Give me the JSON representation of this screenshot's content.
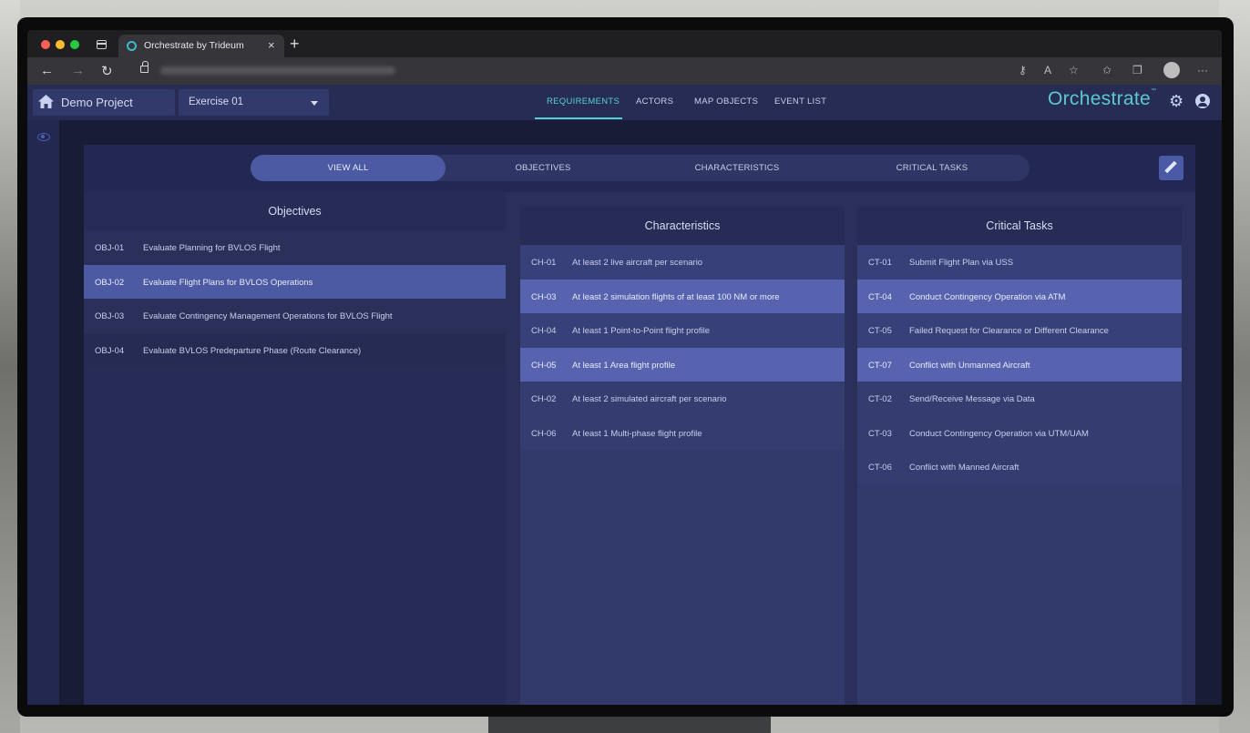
{
  "browser": {
    "tab_title": "Orchestrate by Trideum",
    "tab_close": "×",
    "new_tab": "+"
  },
  "app": {
    "project": "Demo Project",
    "exercise": "Exercise 01",
    "nav_tabs": [
      {
        "label": "REQUIREMENTS",
        "active": true
      },
      {
        "label": "ACTORS",
        "active": false
      },
      {
        "label": "MAP OBJECTS",
        "active": false
      },
      {
        "label": "EVENT LIST",
        "active": false
      }
    ],
    "brand": "Orchestrate",
    "brand_tm": "™",
    "accent_color": "#55d0d0",
    "icons": [
      "home-icon",
      "chevron-down-icon",
      "gear-icon",
      "user-icon",
      "eye-icon",
      "pencil-icon"
    ]
  },
  "filters": [
    {
      "label": "VIEW ALL",
      "active": true
    },
    {
      "label": "OBJECTIVES",
      "active": false
    },
    {
      "label": "CHARACTERISTICS",
      "active": false
    },
    {
      "label": "CRITICAL TASKS",
      "active": false
    }
  ],
  "objectives": {
    "title": "Objectives",
    "items": [
      {
        "code": "OBJ-01",
        "label": "Evaluate Planning for BVLOS Flight",
        "selected": false
      },
      {
        "code": "OBJ-02",
        "label": "Evaluate Flight Plans for BVLOS Operations",
        "selected": true
      },
      {
        "code": "OBJ-03",
        "label": "Evaluate Contingency Management Operations for BVLOS Flight",
        "selected": false
      },
      {
        "code": "OBJ-04",
        "label": "Evaluate BVLOS Predeparture Phase (Route Clearance)",
        "selected": false
      }
    ]
  },
  "characteristics": {
    "title": "Characteristics",
    "items": [
      {
        "code": "CH-01",
        "label": "At least 2 live aircraft per scenario",
        "highlighted": false
      },
      {
        "code": "CH-03",
        "label": "At least 2 simulation flights of at least 100 NM or more",
        "highlighted": true
      },
      {
        "code": "CH-04",
        "label": "At least 1 Point-to-Point flight profile",
        "highlighted": false
      },
      {
        "code": "CH-05",
        "label": "At least 1 Area flight profile",
        "highlighted": true
      },
      {
        "code": "CH-02",
        "label": "At least 2 simulated aircraft per scenario",
        "highlighted": false
      },
      {
        "code": "CH-06",
        "label": "At least 1 Multi-phase flight profile",
        "highlighted": false
      }
    ]
  },
  "critical_tasks": {
    "title": "Critical Tasks",
    "items": [
      {
        "code": "CT-01",
        "label": "Submit Flight Plan via USS",
        "highlighted": false
      },
      {
        "code": "CT-04",
        "label": "Conduct Contingency Operation via ATM",
        "highlighted": true
      },
      {
        "code": "CT-05",
        "label": "Failed Request for Clearance or Different Clearance",
        "highlighted": false
      },
      {
        "code": "CT-07",
        "label": "Conflict with Unmanned Aircraft",
        "highlighted": true
      },
      {
        "code": "CT-02",
        "label": "Send/Receive Message via Data",
        "highlighted": false
      },
      {
        "code": "CT-03",
        "label": "Conduct Contingency Operation via UTM/UAM",
        "highlighted": false
      },
      {
        "code": "CT-06",
        "label": "Conflict with Manned Aircraft",
        "highlighted": false
      }
    ]
  }
}
